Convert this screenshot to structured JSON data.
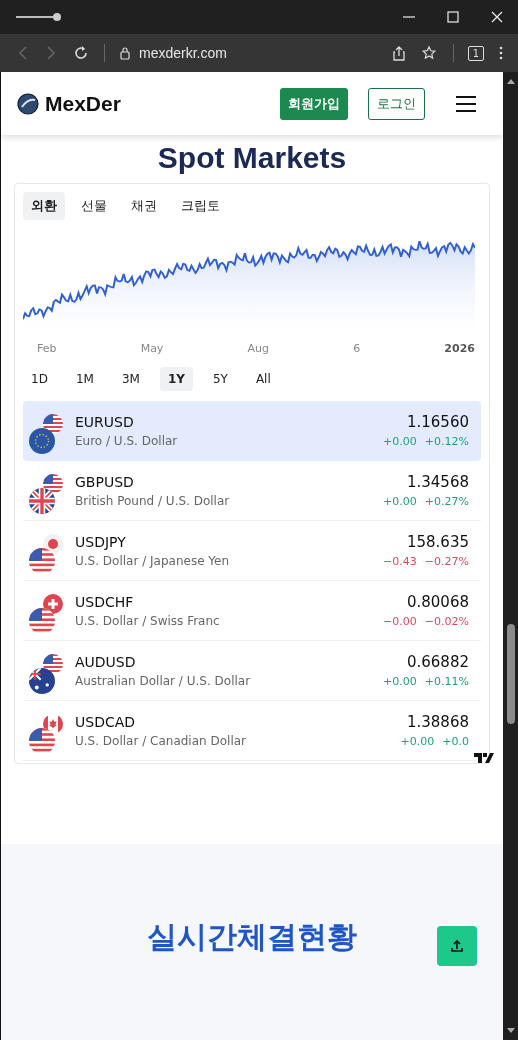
{
  "browser": {
    "url": "mexderkr.com",
    "tab_count": "1"
  },
  "header": {
    "brand": "MexDer",
    "signup": "회원가입",
    "login": "로그인"
  },
  "section_title": "Spot Markets",
  "widget": {
    "tabs": [
      {
        "label": "외환",
        "selected": true
      },
      {
        "label": "선물",
        "selected": false
      },
      {
        "label": "채권",
        "selected": false
      },
      {
        "label": "크립토",
        "selected": false
      }
    ],
    "x_labels": [
      "Feb",
      "May",
      "Aug",
      "6",
      "2026"
    ],
    "ranges": [
      {
        "label": "1D",
        "selected": false
      },
      {
        "label": "1M",
        "selected": false
      },
      {
        "label": "3M",
        "selected": false
      },
      {
        "label": "1Y",
        "selected": true
      },
      {
        "label": "5Y",
        "selected": false
      },
      {
        "label": "All",
        "selected": false
      }
    ],
    "rows": [
      {
        "symbol": "EURUSD",
        "name": "Euro / U.S. Dollar",
        "price": "1.16560",
        "change": "+0.00",
        "change_pct": "+0.12%",
        "positive": true,
        "selected": true,
        "flags": [
          {
            "kind": "eu"
          },
          {
            "kind": "us"
          }
        ]
      },
      {
        "symbol": "GBPUSD",
        "name": "British Pound / U.S. Dollar",
        "price": "1.34568",
        "change": "+0.00",
        "change_pct": "+0.27%",
        "positive": true,
        "selected": false,
        "flags": [
          {
            "kind": "gb"
          },
          {
            "kind": "us"
          }
        ]
      },
      {
        "symbol": "USDJPY",
        "name": "U.S. Dollar / Japanese Yen",
        "price": "158.635",
        "change": "−0.43",
        "change_pct": "−0.27%",
        "positive": false,
        "selected": false,
        "flags": [
          {
            "kind": "us"
          },
          {
            "kind": "jp"
          }
        ]
      },
      {
        "symbol": "USDCHF",
        "name": "U.S. Dollar / Swiss Franc",
        "price": "0.80068",
        "change": "−0.00",
        "change_pct": "−0.02%",
        "positive": false,
        "selected": false,
        "flags": [
          {
            "kind": "us"
          },
          {
            "kind": "ch"
          }
        ]
      },
      {
        "symbol": "AUDUSD",
        "name": "Australian Dollar / U.S. Dollar",
        "price": "0.66882",
        "change": "+0.00",
        "change_pct": "+0.11%",
        "positive": true,
        "selected": false,
        "flags": [
          {
            "kind": "au"
          },
          {
            "kind": "us"
          }
        ]
      },
      {
        "symbol": "USDCAD",
        "name": "U.S. Dollar / Canadian Dollar",
        "price": "1.38868",
        "change": "+0.00",
        "change_pct": "+0.0",
        "positive": true,
        "selected": false,
        "flags": [
          {
            "kind": "us"
          },
          {
            "kind": "ca"
          }
        ]
      }
    ]
  },
  "bottom": {
    "title": "실시간체결현황"
  }
}
